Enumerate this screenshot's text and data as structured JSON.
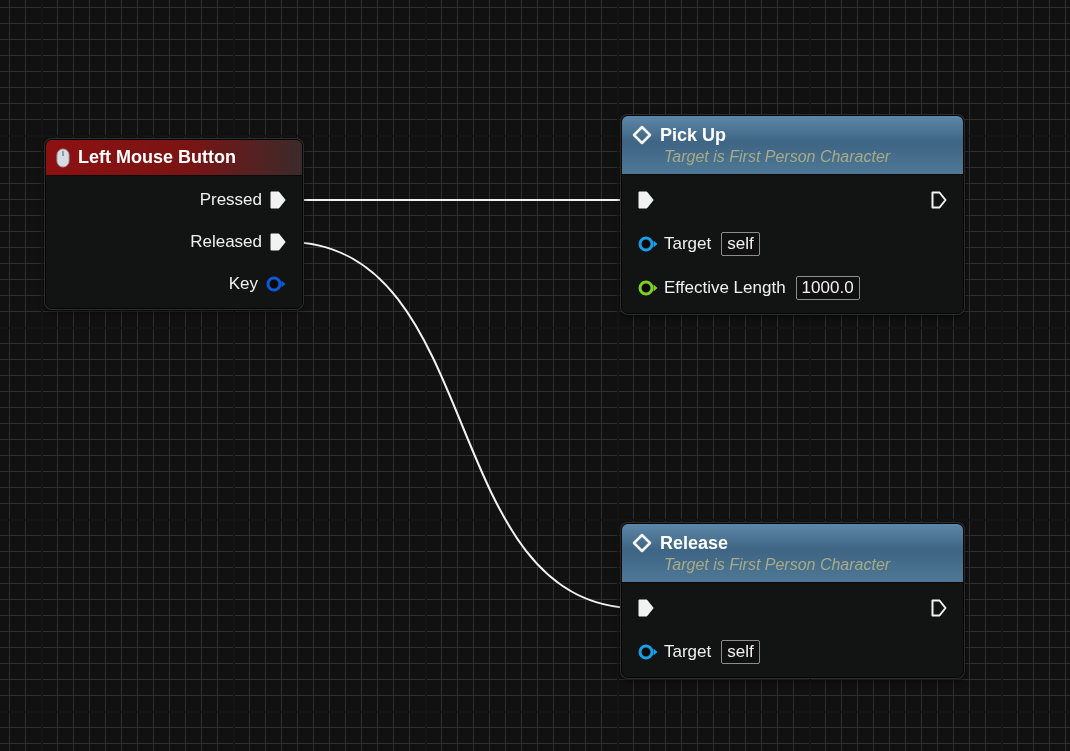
{
  "nodes": [
    {
      "kind": "event",
      "title": "Left Mouse Button",
      "outputs": [
        {
          "kind": "exec",
          "label": "Pressed",
          "connected": true
        },
        {
          "kind": "exec",
          "label": "Released",
          "connected": true
        },
        {
          "kind": "data",
          "label": "Key",
          "connected": false,
          "color": "#0b5bd6"
        }
      ]
    },
    {
      "kind": "function",
      "title": "Pick Up",
      "subtitle": "Target is First Person Character",
      "exec_in": {
        "connected": true
      },
      "exec_out": {
        "connected": false
      },
      "inputs": [
        {
          "label": "Target",
          "value": "self",
          "connected": false,
          "color": "#1a9ee8"
        },
        {
          "label": "Effective Length",
          "value": "1000.0",
          "connected": false,
          "color": "#7ed321"
        }
      ]
    },
    {
      "kind": "function",
      "title": "Release",
      "subtitle": "Target is First Person Character",
      "exec_in": {
        "connected": true
      },
      "exec_out": {
        "connected": false
      },
      "inputs": [
        {
          "label": "Target",
          "value": "self",
          "connected": false,
          "color": "#1a9ee8"
        }
      ]
    }
  ]
}
